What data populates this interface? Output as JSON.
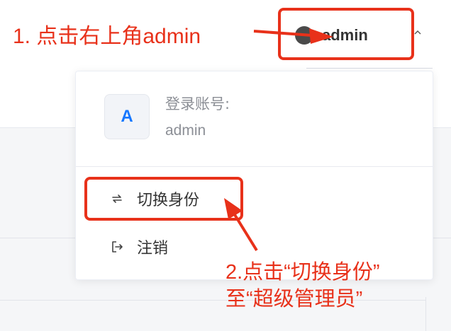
{
  "header": {
    "username": "admin"
  },
  "dropdown": {
    "account_initial": "A",
    "account_label": "登录账号:",
    "account_name": "admin",
    "items": [
      {
        "label": "切换身份",
        "icon": "switch-icon"
      },
      {
        "label": "注销",
        "icon": "logout-icon"
      }
    ]
  },
  "annotations": {
    "step1": "1. 点击右上角admin",
    "step2_line1": "2.点击“切换身份”",
    "step2_line2": "至“超级管理员”",
    "color": "#e8311a"
  },
  "colors": {
    "accent": "#1677ff",
    "text_primary": "#333333",
    "text_muted": "#8c8f96"
  }
}
